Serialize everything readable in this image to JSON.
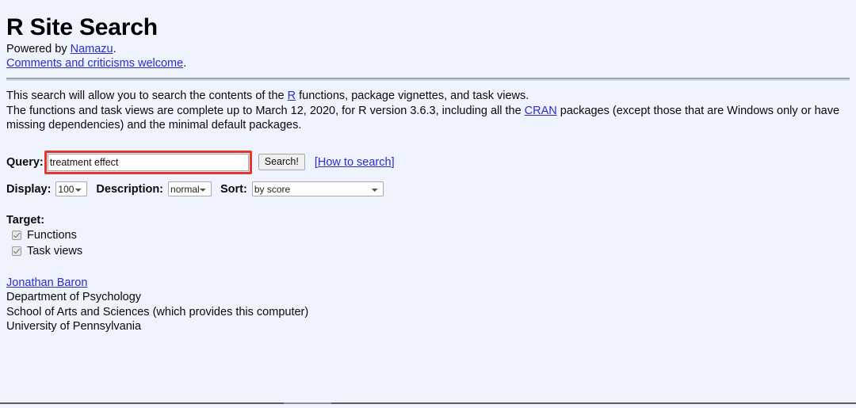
{
  "page": {
    "title": "R Site Search",
    "powered_prefix": "Powered by ",
    "powered_link": "Namazu",
    "powered_suffix": ".",
    "comments_link": "Comments and criticisms welcome",
    "comments_suffix": ".",
    "intro_part1": "This search will allow you to search the contents of the ",
    "intro_link_r": "R",
    "intro_part2": " functions, package vignettes, and task views.",
    "detail_part1": "The functions and task views are complete up to March 12, 2020, for R version 3.6.3, including all the ",
    "detail_link_cran": "CRAN",
    "detail_part2": " packages (except those that are Windows only or have missing dependencies) and the minimal default packages."
  },
  "form": {
    "query_label": "Query:",
    "query_value": "treatment effect",
    "query_placeholder": "",
    "search_button": "Search!",
    "how_to_open_bracket": "[",
    "how_to_label": "How to search",
    "how_to_close_bracket": "]",
    "display_label": "Display:",
    "display_value": "100",
    "display_options": [
      "100"
    ],
    "description_label": "Description:",
    "description_value": "normal",
    "description_options": [
      "normal"
    ],
    "sort_label": "Sort:",
    "sort_value": "by score",
    "sort_options": [
      "by score"
    ]
  },
  "target": {
    "title": "Target:",
    "items": [
      {
        "label": "Functions",
        "checked": true
      },
      {
        "label": "Task views",
        "checked": true
      }
    ]
  },
  "address": {
    "name_link": "Jonathan Baron",
    "line2": "Department of Psychology",
    "line3": "School of Arts and Sciences (which provides this computer)",
    "line4": "University of Pennsylvania"
  },
  "colors": {
    "background": "#eef3fd",
    "link": "#2b2bcf",
    "highlight_box": "#e8352a",
    "rule": "#9aa3ad"
  }
}
